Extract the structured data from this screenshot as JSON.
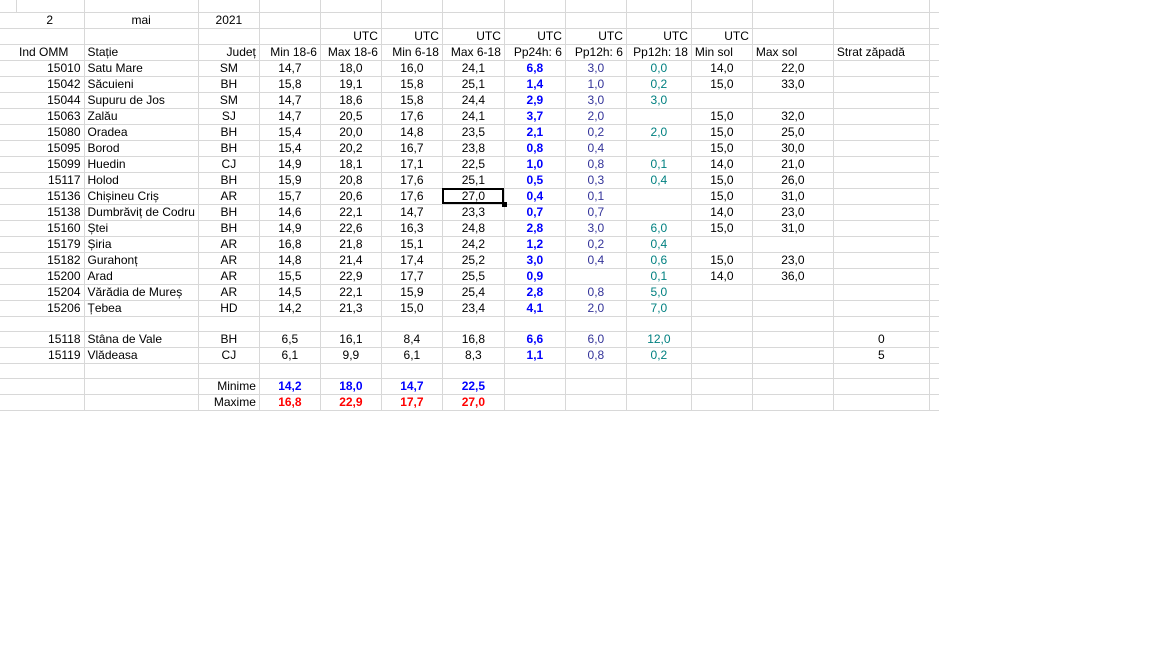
{
  "date": {
    "day": "2",
    "month": "mai",
    "year": "2021"
  },
  "utc_label": "UTC",
  "headers": [
    "Ind OMM",
    "Stație",
    "Județ",
    "Min 18-6",
    "Max 18-6",
    "Min 6-18",
    "Max 6-18",
    "Pp24h: 6",
    "Pp12h: 6",
    "Pp12h: 18",
    "Min sol",
    "Max sol",
    "Strat zăpadă"
  ],
  "stations": [
    {
      "id": "15010",
      "name": "Satu Mare",
      "county": "SM",
      "min186": "14,7",
      "max186": "18,0",
      "min618": "16,0",
      "max618": "24,1",
      "pp24": "6,8",
      "pp12_6": "3,0",
      "pp12_18": "0,0",
      "minsol": "14,0",
      "maxsol": "22,0",
      "snow": ""
    },
    {
      "id": "15042",
      "name": "Săcuieni",
      "county": "BH",
      "min186": "15,8",
      "max186": "19,1",
      "min618": "15,8",
      "max618": "25,1",
      "pp24": "1,4",
      "pp12_6": "1,0",
      "pp12_18": "0,2",
      "minsol": "15,0",
      "maxsol": "33,0",
      "snow": ""
    },
    {
      "id": "15044",
      "name": "Supuru de Jos",
      "county": "SM",
      "min186": "14,7",
      "max186": "18,6",
      "min618": "15,8",
      "max618": "24,4",
      "pp24": "2,9",
      "pp12_6": "3,0",
      "pp12_18": "3,0",
      "minsol": "",
      "maxsol": "",
      "snow": ""
    },
    {
      "id": "15063",
      "name": "Zalău",
      "county": "SJ",
      "min186": "14,7",
      "max186": "20,5",
      "min618": "17,6",
      "max618": "24,1",
      "pp24": "3,7",
      "pp12_6": "2,0",
      "pp12_18": "",
      "minsol": "15,0",
      "maxsol": "32,0",
      "snow": ""
    },
    {
      "id": "15080",
      "name": "Oradea",
      "county": "BH",
      "min186": "15,4",
      "max186": "20,0",
      "min618": "14,8",
      "max618": "23,5",
      "pp24": "2,1",
      "pp12_6": "0,2",
      "pp12_18": "2,0",
      "minsol": "15,0",
      "maxsol": "25,0",
      "snow": ""
    },
    {
      "id": "15095",
      "name": "Borod",
      "county": "BH",
      "min186": "15,4",
      "max186": "20,2",
      "min618": "16,7",
      "max618": "23,8",
      "pp24": "0,8",
      "pp12_6": "0,4",
      "pp12_18": "",
      "minsol": "15,0",
      "maxsol": "30,0",
      "snow": ""
    },
    {
      "id": "15099",
      "name": "Huedin",
      "county": "CJ",
      "min186": "14,9",
      "max186": "18,1",
      "min618": "17,1",
      "max618": "22,5",
      "pp24": "1,0",
      "pp12_6": "0,8",
      "pp12_18": "0,1",
      "minsol": "14,0",
      "maxsol": "21,0",
      "snow": ""
    },
    {
      "id": "15117",
      "name": "Holod",
      "county": "BH",
      "min186": "15,9",
      "max186": "20,8",
      "min618": "17,6",
      "max618": "25,1",
      "pp24": "0,5",
      "pp12_6": "0,3",
      "pp12_18": "0,4",
      "minsol": "15,0",
      "maxsol": "26,0",
      "snow": ""
    },
    {
      "id": "15136",
      "name": "Chișineu   Criș",
      "county": "AR",
      "min186": "15,7",
      "max186": "20,6",
      "min618": "17,6",
      "max618": "27,0",
      "pp24": "0,4",
      "pp12_6": "0,1",
      "pp12_18": "",
      "minsol": "15,0",
      "maxsol": "31,0",
      "snow": ""
    },
    {
      "id": "15138",
      "name": "Dumbrăviț  de Codru",
      "county": "BH",
      "min186": "14,6",
      "max186": "22,1",
      "min618": "14,7",
      "max618": "23,3",
      "pp24": "0,7",
      "pp12_6": "0,7",
      "pp12_18": "",
      "minsol": "14,0",
      "maxsol": "23,0",
      "snow": ""
    },
    {
      "id": "15160",
      "name": "Ștei",
      "county": "BH",
      "min186": "14,9",
      "max186": "22,6",
      "min618": "16,3",
      "max618": "24,8",
      "pp24": "2,8",
      "pp12_6": "3,0",
      "pp12_18": "6,0",
      "minsol": "15,0",
      "maxsol": "31,0",
      "snow": ""
    },
    {
      "id": "15179",
      "name": "Șiria",
      "county": "AR",
      "min186": "16,8",
      "max186": "21,8",
      "min618": "15,1",
      "max618": "24,2",
      "pp24": "1,2",
      "pp12_6": "0,2",
      "pp12_18": "0,4",
      "minsol": "",
      "maxsol": "",
      "snow": ""
    },
    {
      "id": "15182",
      "name": "Gurahonț",
      "county": "AR",
      "min186": "14,8",
      "max186": "21,4",
      "min618": "17,4",
      "max618": "25,2",
      "pp24": "3,0",
      "pp12_6": "0,4",
      "pp12_18": "0,6",
      "minsol": "15,0",
      "maxsol": "23,0",
      "snow": ""
    },
    {
      "id": "15200",
      "name": "Arad",
      "county": "AR",
      "min186": "15,5",
      "max186": "22,9",
      "min618": "17,7",
      "max618": "25,5",
      "pp24": "0,9",
      "pp12_6": "",
      "pp12_18": "0,1",
      "minsol": "14,0",
      "maxsol": "36,0",
      "snow": ""
    },
    {
      "id": "15204",
      "name": "Vărădia de Mureș",
      "county": "AR",
      "min186": "14,5",
      "max186": "22,1",
      "min618": "15,9",
      "max618": "25,4",
      "pp24": "2,8",
      "pp12_6": "0,8",
      "pp12_18": "5,0",
      "minsol": "",
      "maxsol": "",
      "snow": ""
    },
    {
      "id": "15206",
      "name": "Țebea",
      "county": "HD",
      "min186": "14,2",
      "max186": "21,3",
      "min618": "15,0",
      "max618": "23,4",
      "pp24": "4,1",
      "pp12_6": "2,0",
      "pp12_18": "7,0",
      "minsol": "",
      "maxsol": "",
      "snow": ""
    }
  ],
  "mountain_stations": [
    {
      "id": "15118",
      "name": "Stâna de Vale",
      "county": "BH",
      "min186": "6,5",
      "max186": "16,1",
      "min618": "8,4",
      "max618": "16,8",
      "pp24": "6,6",
      "pp12_6": "6,0",
      "pp12_18": "12,0",
      "minsol": "",
      "maxsol": "",
      "snow": "0"
    },
    {
      "id": "15119",
      "name": "Vlădeasa",
      "county": "CJ",
      "min186": "6,1",
      "max186": "9,9",
      "min618": "6,1",
      "max618": "8,3",
      "pp24": "1,1",
      "pp12_6": "0,8",
      "pp12_18": "0,2",
      "minsol": "",
      "maxsol": "",
      "snow": "5"
    }
  ],
  "summary": {
    "min_label": "Minime",
    "max_label": "Maxime",
    "min_values": [
      "14,2",
      "18,0",
      "14,7",
      "22,5"
    ],
    "max_values": [
      "16,8",
      "22,9",
      "17,7",
      "27,0"
    ]
  },
  "colors": {
    "blue": "#0000ff",
    "navy": "#333399",
    "teal": "#008080",
    "red": "#ff0000",
    "grid": "#d8d8d8"
  },
  "selected_cell": "Max 6-18 / 15136"
}
